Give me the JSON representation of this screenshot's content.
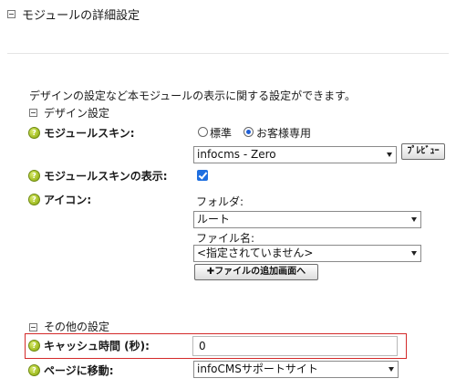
{
  "header": {
    "title": "モジュールの詳細設定"
  },
  "description": "デザインの設定など本モジュールの表示に関する設定ができます。",
  "design_section": {
    "title": "デザイン設定",
    "skin": {
      "label": "モジュールスキン:",
      "radio_standard": "標準",
      "radio_custom": "お客様専用",
      "selected_option": "custom",
      "select_value": "infocms - Zero",
      "preview_button": "ﾌﾟﾚﾋﾞｭｰ"
    },
    "skin_display": {
      "label": "モジュールスキンの表示:",
      "checked": true
    },
    "icon": {
      "label": "アイコン:",
      "folder_label": "フォルダ:",
      "folder_value": "ルート",
      "file_label": "ファイル名:",
      "file_value": "<指定されていません>",
      "add_file_button": "ファイルの追加画面へ"
    }
  },
  "other_section": {
    "title": "その他の設定",
    "cache": {
      "label": "キャッシュ時間 (秒):",
      "value": "0"
    },
    "page_move": {
      "label": "ページに移動:",
      "value": "infoCMSサポートサイト"
    }
  },
  "colors": {
    "highlight_border": "#d42a2a",
    "checkbox": "#1f6fe0",
    "help_icon": "#a7c22a"
  }
}
